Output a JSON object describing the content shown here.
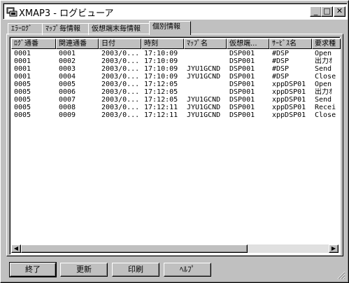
{
  "window": {
    "title": "XMAP3 - ログビューア",
    "min": "_",
    "max": "□",
    "close": "✕"
  },
  "tabs": [
    {
      "label": "ｴﾗｰﾛｸﾞ"
    },
    {
      "label": "ﾏｯﾌﾟ毎情報"
    },
    {
      "label": "仮想端末毎情報"
    },
    {
      "label": "個別情報"
    }
  ],
  "active_tab": "個別情報",
  "table": {
    "columns": [
      "ﾛｸﾞ通番",
      "関連通番",
      "日付",
      "時刻",
      "ﾏｯﾌﾟ名",
      "仮想端...",
      "ｻｰﾋﾞｽ名",
      "要求種"
    ],
    "rows": [
      [
        "0001",
        "0001",
        "2003/0...",
        "17:10:09",
        "",
        "DSP001",
        "#DSP",
        "Open"
      ],
      [
        "0001",
        "0002",
        "2003/0...",
        "17:10:09",
        "",
        "DSP001",
        "#DSP",
        "出力ｵ"
      ],
      [
        "0001",
        "0003",
        "2003/0...",
        "17:10:09",
        "JYU1GCND",
        "DSP001",
        "#DSP",
        "Send"
      ],
      [
        "0001",
        "0004",
        "2003/0...",
        "17:10:09",
        "JYU1GCND",
        "DSP001",
        "#DSP",
        "Close"
      ],
      [
        "0005",
        "0005",
        "2003/0...",
        "17:12:05",
        "",
        "DSP001",
        "xppDSP01",
        "Open"
      ],
      [
        "0005",
        "0006",
        "2003/0...",
        "17:12:05",
        "",
        "DSP001",
        "xppDSP01",
        "出力ｵ"
      ],
      [
        "0005",
        "0007",
        "2003/0...",
        "17:12:05",
        "JYU1GCND",
        "DSP001",
        "xppDSP01",
        "Send"
      ],
      [
        "0005",
        "0008",
        "2003/0...",
        "17:12:11",
        "JYU1GCND",
        "DSP001",
        "xppDSP01",
        "Recei"
      ],
      [
        "0005",
        "0009",
        "2003/0...",
        "17:12:11",
        "JYU1GCND",
        "DSP001",
        "xppDSP01",
        "Close"
      ]
    ]
  },
  "scrollbar": {
    "left": "◀",
    "right": "▶"
  },
  "buttons": {
    "end": "終了",
    "update": "更新",
    "print": "印刷",
    "help": "ﾍﾙﾌﾟ"
  }
}
